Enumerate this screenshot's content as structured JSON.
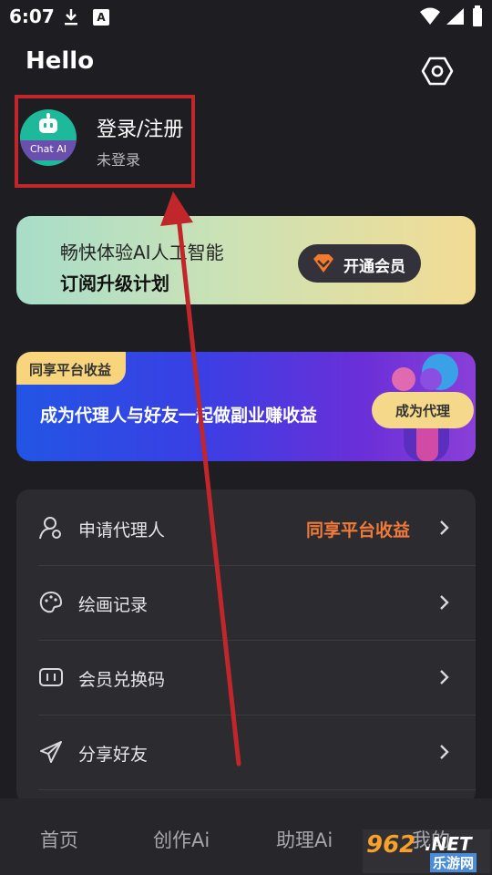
{
  "status_bar": {
    "time": "6:07",
    "app_icon_letter": "A"
  },
  "header": {
    "greeting": "Hello"
  },
  "profile": {
    "avatar_label": "Chat AI",
    "title": "登录/注册",
    "subtitle": "未登录",
    "highlight_color": "#c0262a"
  },
  "member_card": {
    "line1": "畅快体验AI人工智能",
    "line2": "订阅升级计划",
    "button_label": "开通会员"
  },
  "agent_card": {
    "tag": "同享平台收益",
    "text": "成为代理人与好友一起做副业赚收益",
    "button_label": "成为代理"
  },
  "menu": {
    "items": [
      {
        "label": "申请代理人",
        "extra": "同享平台收益",
        "icon": "agent-person-icon"
      },
      {
        "label": "绘画记录",
        "extra": "",
        "icon": "palette-icon"
      },
      {
        "label": "会员兑换码",
        "extra": "",
        "icon": "code-card-icon"
      },
      {
        "label": "分享好友",
        "extra": "",
        "icon": "paper-plane-icon"
      }
    ],
    "accent": "#f07a3a"
  },
  "tabbar": {
    "tabs": [
      "首页",
      "创作Ai",
      "助理Ai",
      "我的"
    ]
  },
  "watermark": {
    "num": "962",
    "net": ".NET",
    "sub": "乐游网"
  }
}
